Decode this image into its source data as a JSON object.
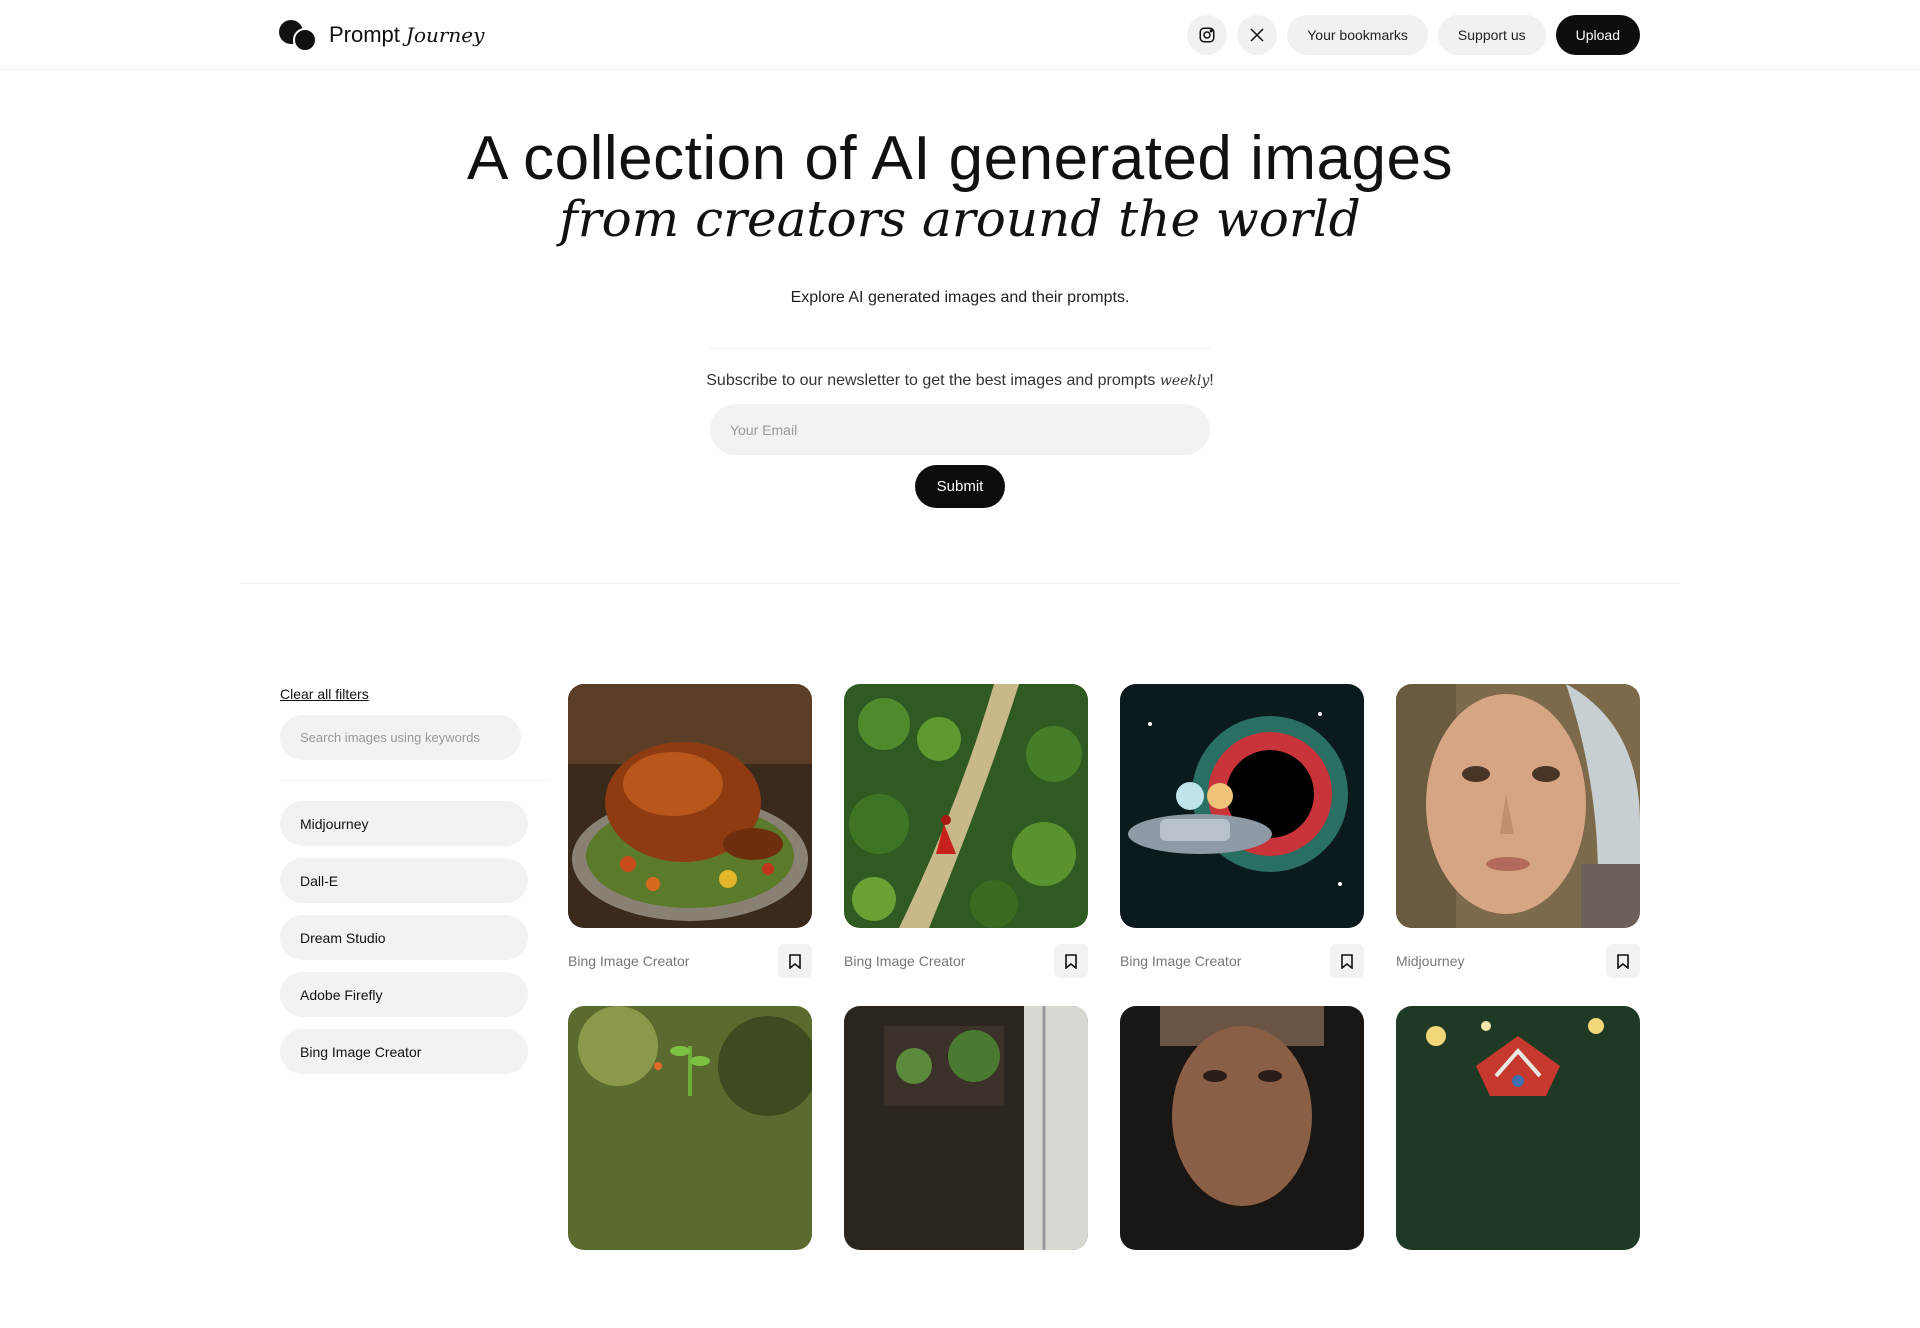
{
  "brand": {
    "name": "Prompt",
    "name_script": "Journey"
  },
  "nav": {
    "bookmarks": "Your bookmarks",
    "support": "Support us",
    "upload": "Upload"
  },
  "hero": {
    "title": "A collection of AI generated images",
    "subtitle": "from creators around the world",
    "explore": "Explore AI generated images and their prompts."
  },
  "newsletter": {
    "text": "Subscribe to our newsletter to get the best images and prompts",
    "emphasis": "weekly",
    "suffix": "!",
    "email_placeholder": "Your Email",
    "submit": "Submit"
  },
  "sidebar": {
    "clear_filters": "Clear all filters",
    "search_placeholder": "Search images using keywords",
    "filters": [
      "Midjourney",
      "Dall-E",
      "Dream Studio",
      "Adobe Firefly",
      "Bing Image Creator"
    ]
  },
  "gallery": [
    {
      "source": "Bing Image Creator",
      "image": "roast-turkey-platter"
    },
    {
      "source": "Bing Image Creator",
      "image": "forest-path-red-cloak"
    },
    {
      "source": "Bing Image Creator",
      "image": "cartoon-spaceship-black-hole"
    },
    {
      "source": "Midjourney",
      "image": "android-girl-portrait"
    },
    {
      "source": "",
      "image": "plant-sprout"
    },
    {
      "source": "",
      "image": "greenhouse-interior"
    },
    {
      "source": "",
      "image": "veiled-woman-portrait"
    },
    {
      "source": "",
      "image": "festive-ornament"
    }
  ],
  "colors": {
    "accent": "#0d0d0d",
    "pill_bg": "#f1f1f1",
    "muted_text": "#777777"
  }
}
